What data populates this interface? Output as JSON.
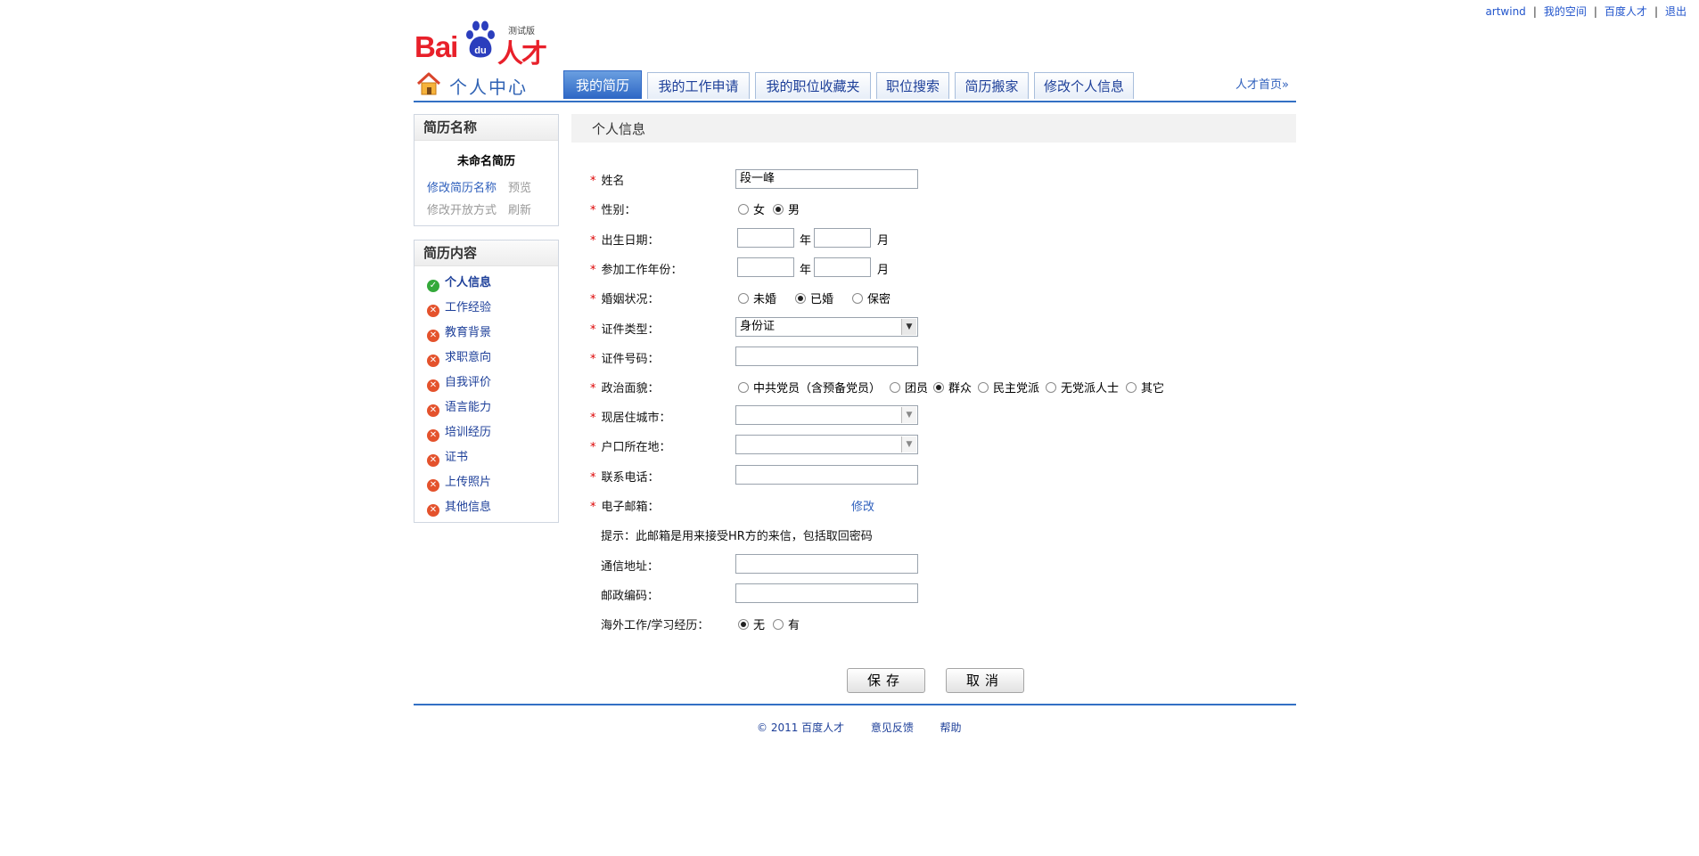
{
  "top_links": [
    "artwind",
    "我的空间",
    "百度人才",
    "退出"
  ],
  "logo": {
    "brand": "Bai",
    "paw_text": "du",
    "product": "人才",
    "badge": "测试版"
  },
  "nav": {
    "title": "个人中心",
    "tabs": [
      "我的简历",
      "我的工作申请",
      "我的职位收藏夹",
      "职位搜索",
      "简历搬家",
      "修改个人信息"
    ],
    "active_tab": "我的简历",
    "portal_link": "人才首页»"
  },
  "sidebar": {
    "resume_box": {
      "header": "简历名称",
      "resume_name": "未命名简历",
      "rename": "修改简历名称",
      "preview": "预览",
      "change_open": "修改开放方式",
      "refresh": "刷新"
    },
    "content_box": {
      "header": "简历内容",
      "items": [
        {
          "label": "个人信息",
          "status": "ok"
        },
        {
          "label": "工作经验",
          "status": "missing"
        },
        {
          "label": "教育背景",
          "status": "missing"
        },
        {
          "label": "求职意向",
          "status": "missing"
        },
        {
          "label": "自我评价",
          "status": "missing"
        },
        {
          "label": "语言能力",
          "status": "missing"
        },
        {
          "label": "培训经历",
          "status": "missing"
        },
        {
          "label": "证书",
          "status": "missing"
        },
        {
          "label": "上传照片",
          "status": "missing"
        },
        {
          "label": "其他信息",
          "status": "missing"
        }
      ]
    }
  },
  "section_title": "个人信息",
  "form": {
    "name_label": "姓名",
    "name_value": "段一峰",
    "gender_label": "性别：",
    "gender_options": [
      "女",
      "男"
    ],
    "gender_selected": "男",
    "birth_label": "出生日期：",
    "work_year_label": "参加工作年份：",
    "year_unit": "年",
    "month_unit": "月",
    "marital_label": "婚姻状况：",
    "marital_options": [
      "未婚",
      "已婚",
      "保密"
    ],
    "marital_selected": "已婚",
    "id_type_label": "证件类型：",
    "id_type_value": "身份证",
    "id_number_label": "证件号码：",
    "political_label": "政治面貌：",
    "political_options": [
      "中共党员（含预备党员）",
      "团员",
      "群众",
      "民主党派",
      "无党派人士",
      "其它"
    ],
    "political_selected": "群众",
    "city_label": "现居住城市：",
    "hukou_label": "户口所在地：",
    "phone_label": "联系电话：",
    "email_label": "电子邮箱：",
    "email_edit": "修改",
    "email_hint": "提示：此邮箱是用来接受HR方的来信，包括取回密码",
    "address_label": "通信地址：",
    "postcode_label": "邮政编码：",
    "overseas_label": "海外工作/学习经历：",
    "overseas_options": [
      "无",
      "有"
    ],
    "overseas_selected": "无"
  },
  "buttons": {
    "save": "保存",
    "cancel": "取消"
  },
  "footer": [
    "© 2011 百度人才",
    "意见反馈",
    "帮助"
  ],
  "colors": {
    "accent_blue": "#3370c4",
    "brand_red": "#e8202a",
    "required_red": "#dd0000"
  }
}
